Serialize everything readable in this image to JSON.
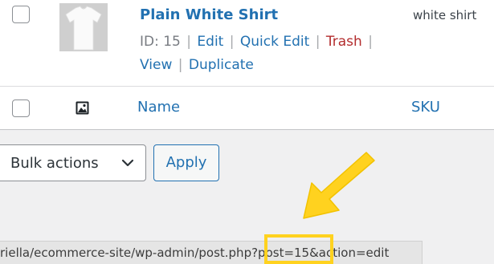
{
  "product_row": {
    "name": "Plain White Shirt",
    "sku": "white shirt",
    "id_label": "ID: 15",
    "actions": {
      "edit": "Edit",
      "quick_edit": "Quick Edit",
      "trash": "Trash",
      "view": "View",
      "duplicate": "Duplicate"
    },
    "separator": "|"
  },
  "table_footer": {
    "name_label": "Name",
    "sku_label": "SKU",
    "image_icon": "image-icon"
  },
  "bulk_actions": {
    "selected": "Bulk actions",
    "apply_label": "Apply"
  },
  "status_bar": {
    "url": "riella/ecommerce-site/wp-admin/post.php?post=15&action=edit"
  },
  "annotation": {
    "color": "#ffd21f",
    "icon": "arrow-icon"
  },
  "colors": {
    "link": "#2271b1",
    "trash": "#b32d2e",
    "background": "#f0f0f1"
  }
}
